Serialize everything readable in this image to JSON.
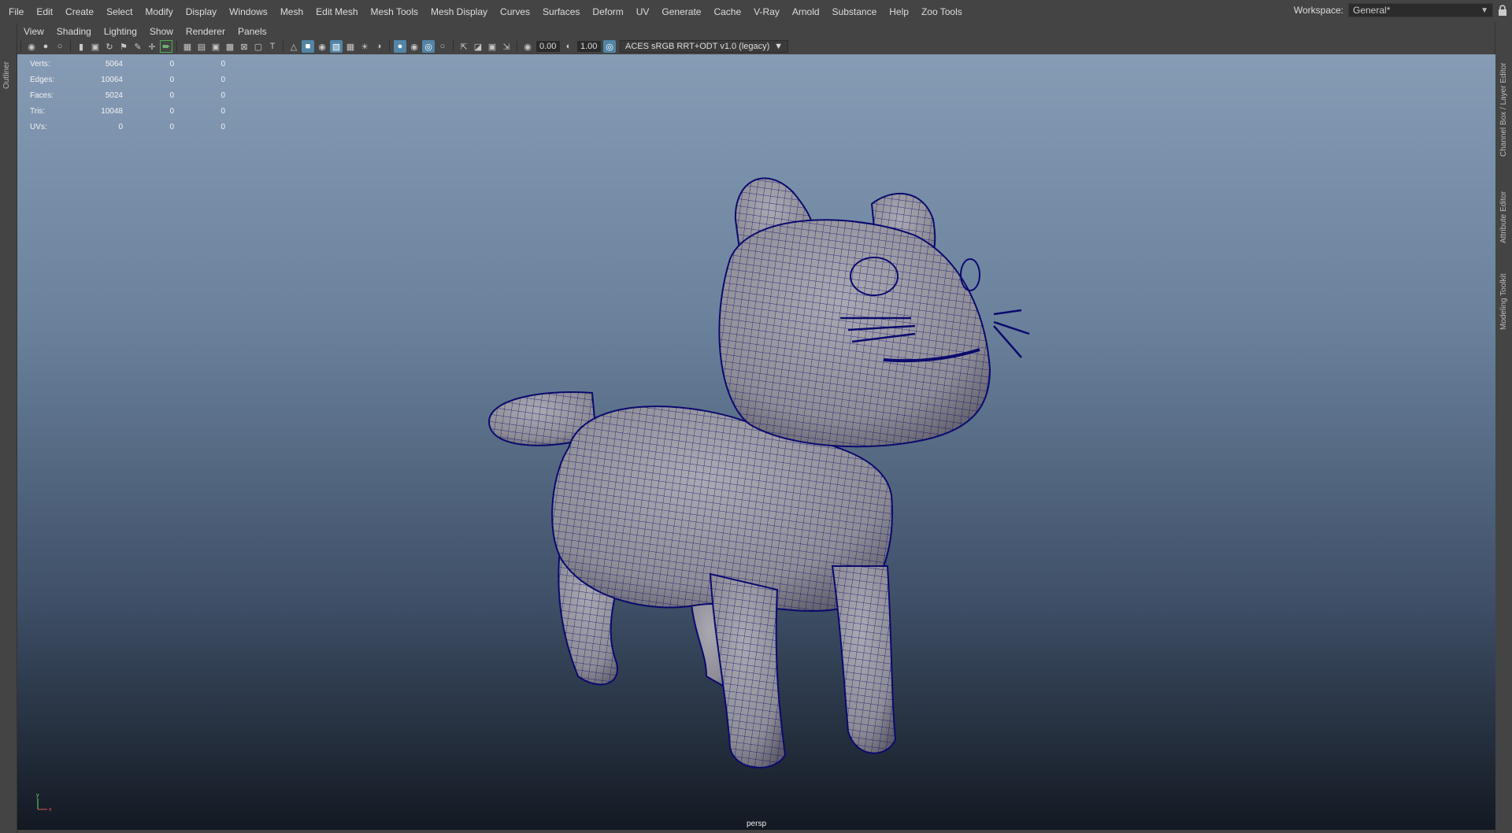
{
  "menubar": {
    "items": [
      "File",
      "Edit",
      "Create",
      "Select",
      "Modify",
      "Display",
      "Windows",
      "Mesh",
      "Edit Mesh",
      "Mesh Tools",
      "Mesh Display",
      "Curves",
      "Surfaces",
      "Deform",
      "UV",
      "Generate",
      "Cache",
      "V-Ray",
      "Arnold",
      "Substance",
      "Help",
      "Zoo Tools"
    ]
  },
  "workspace": {
    "label": "Workspace:",
    "value": "General*"
  },
  "left_panel": {
    "outliner": "Outliner"
  },
  "right_panel": {
    "channel_box": "Channel Box / Layer Editor",
    "attribute_editor": "Attribute Editor",
    "modeling_toolkit": "Modeling Toolkit"
  },
  "panel_menus": [
    "View",
    "Shading",
    "Lighting",
    "Show",
    "Renderer",
    "Panels"
  ],
  "toolbar": {
    "exposure": "0.00",
    "gamma": "1.00",
    "color_space": "ACES sRGB RRT+ODT v1.0 (legacy)"
  },
  "hud": {
    "rows": [
      {
        "label": "Verts:",
        "c1": "5064",
        "c2": "0",
        "c3": "0"
      },
      {
        "label": "Edges:",
        "c1": "10064",
        "c2": "0",
        "c3": "0"
      },
      {
        "label": "Faces:",
        "c1": "5024",
        "c2": "0",
        "c3": "0"
      },
      {
        "label": "Tris:",
        "c1": "10048",
        "c2": "0",
        "c3": "0"
      },
      {
        "label": "UVs:",
        "c1": "0",
        "c2": "0",
        "c3": "0"
      }
    ]
  },
  "viewport": {
    "camera": "persp",
    "axis_y": "y",
    "axis_x": "x"
  },
  "colors": {
    "wire": "#0a0a6e",
    "mesh": "#8e8d96",
    "bg_top": "#869cb5",
    "bg_bottom": "#131922",
    "active_icon": "#5285a6"
  }
}
